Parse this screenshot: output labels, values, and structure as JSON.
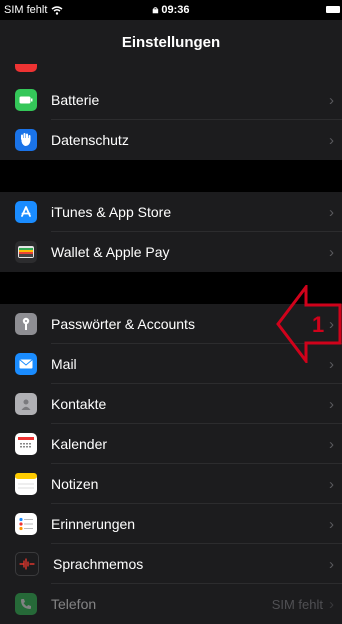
{
  "status_bar": {
    "carrier": "SIM fehlt",
    "time": "09:36"
  },
  "navbar": {
    "title": "Einstellungen"
  },
  "group1": [
    {
      "label": "Batterie",
      "icon": "battery-icon",
      "color": "#34c759"
    },
    {
      "label": "Datenschutz",
      "icon": "hand-icon",
      "color": "#1a73e8"
    }
  ],
  "group2": [
    {
      "label": "iTunes & App Store",
      "icon": "app-store-icon",
      "color": "#1a8cff"
    },
    {
      "label": "Wallet & Apple Pay",
      "icon": "wallet-icon",
      "color": "#2c2c2e"
    }
  ],
  "group3": [
    {
      "label": "Passwörter & Accounts",
      "icon": "key-icon",
      "color": "#8e8e93"
    },
    {
      "label": "Mail",
      "icon": "mail-icon",
      "color": "#1a8cff"
    },
    {
      "label": "Kontakte",
      "icon": "contacts-icon",
      "color": "#b0b0b4"
    },
    {
      "label": "Kalender",
      "icon": "calendar-icon",
      "color": "#ffffff"
    },
    {
      "label": "Notizen",
      "icon": "notes-icon",
      "color": "#ffffff"
    },
    {
      "label": "Erinnerungen",
      "icon": "reminders-icon",
      "color": "#ffffff"
    },
    {
      "label": "Sprachmemos",
      "icon": "voice-memos-icon",
      "color": "#1c1c1e"
    },
    {
      "label": "Telefon",
      "value": "SIM fehlt",
      "icon": "phone-icon",
      "color": "#34c759"
    }
  ],
  "annotation": {
    "number": "1",
    "color": "#d0021b"
  }
}
